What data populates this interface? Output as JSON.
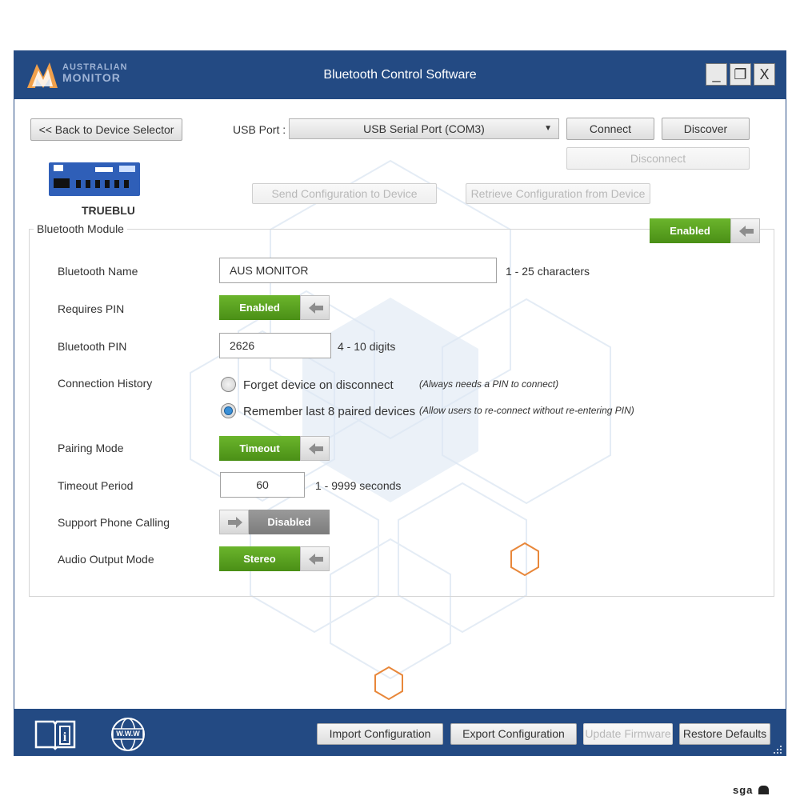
{
  "window": {
    "title": "Bluetooth Control Software",
    "logo_line1": "AUSTRALIAN",
    "logo_line2": "MONITOR",
    "minimize": "_",
    "maximize": "❐",
    "close": "X"
  },
  "toolbar": {
    "back_label": "<<  Back to Device Selector",
    "usb_port_label": "USB Port :",
    "usb_port_value": "USB Serial Port (COM3)",
    "connect_label": "Connect",
    "discover_label": "Discover",
    "disconnect_label": "Disconnect",
    "send_label": "Send Configuration to Device",
    "retrieve_label": "Retrieve Configuration from Device"
  },
  "device": {
    "name": "TRUEBLU"
  },
  "module": {
    "group_label": "Bluetooth Module",
    "enabled_label": "Enabled"
  },
  "settings": {
    "bluetooth_name_label": "Bluetooth Name",
    "bluetooth_name_value": "AUS MONITOR",
    "bluetooth_name_hint": "1 - 25 characters",
    "requires_pin_label": "Requires PIN",
    "requires_pin_value": "Enabled",
    "bluetooth_pin_label": "Bluetooth PIN",
    "bluetooth_pin_value": "2626",
    "bluetooth_pin_hint": "4 - 10 digits",
    "connection_history_label": "Connection History",
    "history_option1": "Forget device on disconnect",
    "history_option1_note": "(Always needs a PIN to connect)",
    "history_option2": "Remember last 8 paired devices",
    "history_option2_note": "(Allow users to re-connect without re-entering PIN)",
    "pairing_mode_label": "Pairing Mode",
    "pairing_mode_value": "Timeout",
    "timeout_period_label": "Timeout Period",
    "timeout_period_value": "60",
    "timeout_period_hint": "1 - 9999 seconds",
    "support_phone_label": "Support Phone Calling",
    "support_phone_value": "Disabled",
    "audio_output_label": "Audio Output Mode",
    "audio_output_value": "Stereo"
  },
  "footer": {
    "import_label": "Import Configuration",
    "export_label": "Export Configuration",
    "update_label": "Update Firmware",
    "restore_label": "Restore Defaults",
    "www_label": "W.W.W"
  },
  "watermark": "sga",
  "colors": {
    "titlebar": "#234a83",
    "toggle_on": "#5aa11f",
    "toggle_off": "#8a8a8a",
    "accent_orange": "#e8873a"
  }
}
